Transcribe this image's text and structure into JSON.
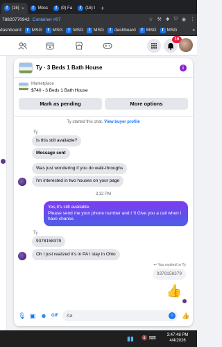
{
  "browser": {
    "tabs": [
      {
        "label": "(16)",
        "active": true
      },
      {
        "label": "Mess"
      },
      {
        "label": "(9) Fa"
      },
      {
        "label": "(16) t"
      }
    ],
    "new_tab": "+",
    "url_text": "78820770942",
    "container_label": "Container #07",
    "bookmarks": [
      {
        "label": "dashboard",
        "icon": "facebook"
      },
      {
        "label": "MSG",
        "icon": "facebook"
      },
      {
        "label": "MSG",
        "icon": "facebook"
      },
      {
        "label": "MSG",
        "icon": "facebook"
      },
      {
        "label": "MSG",
        "icon": "facebook"
      },
      {
        "label": "dashboard",
        "icon": "facebook"
      },
      {
        "label": "MSG",
        "icon": "facebook"
      },
      {
        "label": "MSG",
        "icon": "facebook"
      }
    ],
    "bookmarks_overflow": "»"
  },
  "fb_nav": {
    "notification_count": "16"
  },
  "chat": {
    "title": "Ty · 3 Beds 1 Bath House",
    "info_icon": "i",
    "listing": {
      "label": "Marketplace",
      "subtitle": "$740 - 3 Beds 1 Bath House",
      "mark_pending": "Mark as pending",
      "more_options": "More options"
    },
    "started_text": "Ty started this chat.",
    "view_profile": "View buyer profile",
    "sender_name": "Ty",
    "messages_block1": [
      "Is this still available?",
      "Message sent",
      "Was just wondering if you do walk-throughs",
      "I'm interested in two houses on your page"
    ],
    "timestamp": "3:32 PM",
    "outgoing": "Yes,It's still available.\nPlease send me your phone number and I 'll Give you a call when I have chance.",
    "sender_name2": "Ty",
    "messages_block2": [
      "9378158379",
      "Oh I just realized it's in PA I stay in Ohio"
    ],
    "reply_note": "You replied to Ty",
    "reply_quote": "9378158379",
    "composer_placeholder": "Aa"
  },
  "taskbar": {
    "time": "3:47:48 PM",
    "date": "4/4/2026"
  },
  "colors": {
    "accent": "#1877f2",
    "outgoing_bubble": "#6a4bea",
    "notification": "#e41e3f"
  }
}
